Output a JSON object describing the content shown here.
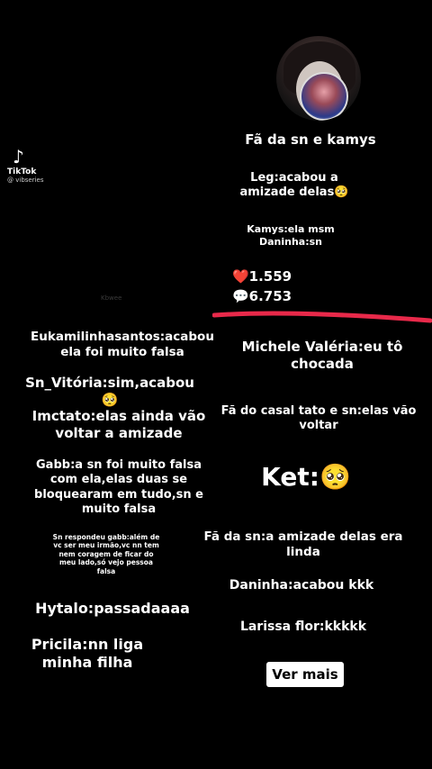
{
  "tiktok": {
    "logo_icon": "tiktok-icon",
    "brand": "TikTok",
    "handle": "@ vibseries"
  },
  "watermark": "Kbwee",
  "post": {
    "title": "Fã da sn e kamys",
    "line1": "Leg:acabou a\namizade delas🥺",
    "line2": "Kamys:ela msm\nDaninha:sn",
    "likes": "❤️1.559",
    "comments": "💬6.753"
  },
  "left_comments": [
    "Eukamilinhasantos:acabou\nela foi muito falsa",
    "Sn_Vitória:sim,acabou🥺",
    "Imctato:elas ainda vão\nvoltar a amizade",
    "Gabb:a sn foi muito falsa\ncom ela,elas duas se\nbloquearam em tudo,sn e\nmuito falsa",
    "Sn respondeu gabb:além de\nvc ser meu irmão,vc nn tem\nnem coragem de ficar do\nmeu lado,só vejo pessoa\nfalsa",
    "Hytalo:passadaaaa",
    "Pricila:nn liga\nminha filha"
  ],
  "right_comments": [
    "Michele Valéria:eu tô\nchocada",
    "Fã do casal tato e sn:elas vão\nvoltar",
    "Ket:🥺",
    "Fã da sn:a amizade delas era\nlinda",
    "Daninha:acabou kkk",
    "Larissa flor:kkkkk"
  ],
  "more_button": "Ver mais",
  "colors": {
    "background": "#000000",
    "accent_line": "#e8294a",
    "button_bg": "#ffffff"
  }
}
